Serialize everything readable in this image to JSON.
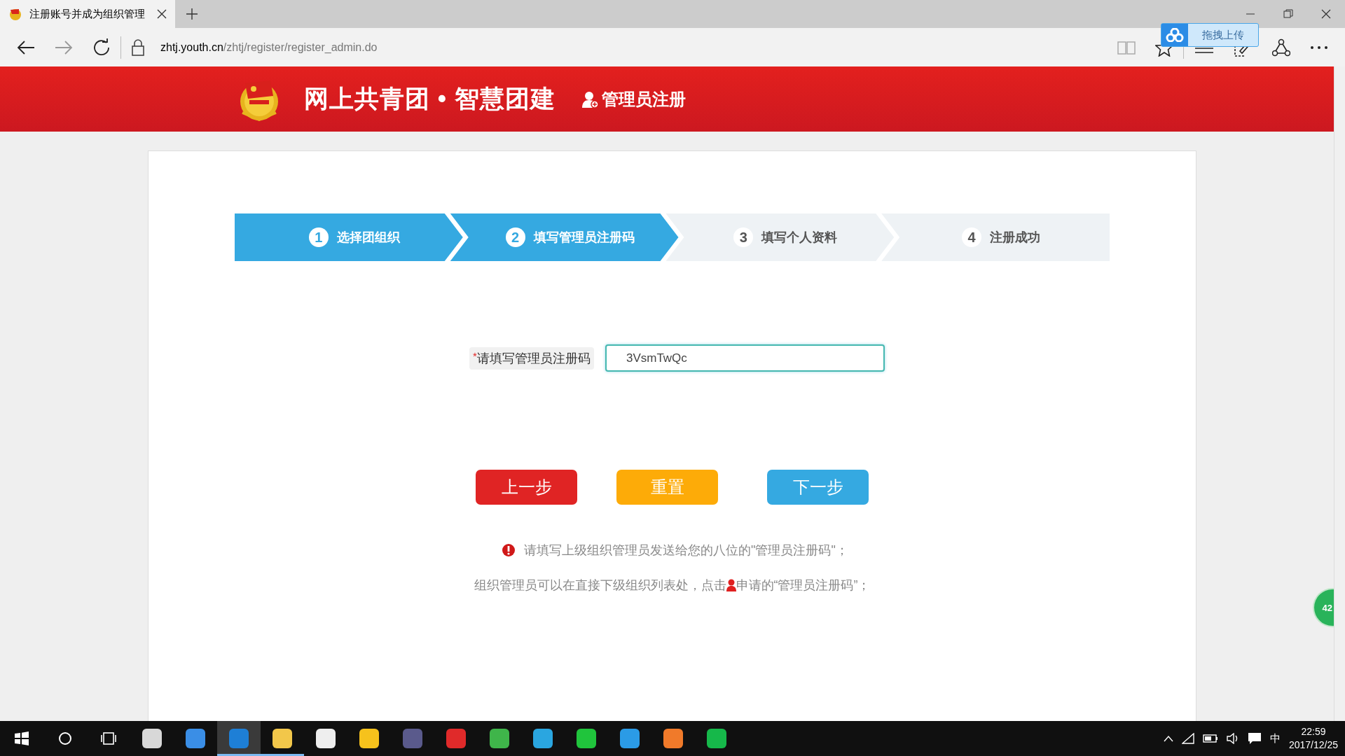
{
  "browser": {
    "tab": {
      "title": "注册账号并成为组织管理",
      "selected": true
    },
    "address": {
      "host": "zhtj.youth.cn",
      "path": "/zhtj/register/register_admin.do"
    },
    "upload_widget": {
      "label": "拖拽上传"
    }
  },
  "header": {
    "title": "网上共青团 • 智慧团建",
    "subtitle": "管理员注册"
  },
  "steps": [
    {
      "number": "1",
      "label": "选择团组织",
      "active": true
    },
    {
      "number": "2",
      "label": "填写管理员注册码",
      "active": true
    },
    {
      "number": "3",
      "label": "填写个人资料",
      "active": false
    },
    {
      "number": "4",
      "label": "注册成功",
      "active": false
    }
  ],
  "form": {
    "required_mark": "*",
    "label": "请填写管理员注册码",
    "value": "3VsmTwQc"
  },
  "buttons": [
    {
      "label": "上一步",
      "kind": "prev"
    },
    {
      "label": "重置",
      "kind": "reset"
    },
    {
      "label": "下一步",
      "kind": "next"
    }
  ],
  "notes": {
    "line_1": "请填写上级组织管理员发送给您的八位的\"管理员注册码\"；",
    "line_2_before": "组织管理员可以在直接下级组织列表处，点击",
    "line_2_after": "申请的“管理员注册码”；"
  },
  "float_ball": {
    "text": "42"
  },
  "taskbar": {
    "items": [
      {
        "kind": "start",
        "selected": false,
        "running": false
      },
      {
        "kind": "search",
        "selected": false,
        "running": false
      },
      {
        "kind": "taskview",
        "selected": false,
        "running": false
      },
      {
        "kind": "app",
        "color": "#d8d8d8",
        "selected": false,
        "running": false
      },
      {
        "kind": "app",
        "color": "#3a8ee6",
        "selected": false,
        "running": false
      },
      {
        "kind": "app",
        "color": "#1e7fd6",
        "selected": true,
        "running": true
      },
      {
        "kind": "app",
        "color": "#f2c74a",
        "selected": false,
        "running": true
      },
      {
        "kind": "app",
        "color": "#eeeeee",
        "selected": false,
        "running": false
      },
      {
        "kind": "app",
        "color": "#f6c21c",
        "selected": false,
        "running": false
      },
      {
        "kind": "app",
        "color": "#5a5a8c",
        "selected": false,
        "running": false
      },
      {
        "kind": "app",
        "color": "#e02a2a",
        "selected": false,
        "running": false
      },
      {
        "kind": "app",
        "color": "#3fb54a",
        "selected": false,
        "running": false
      },
      {
        "kind": "app",
        "color": "#2aa6e0",
        "selected": false,
        "running": false
      },
      {
        "kind": "app",
        "color": "#20c43c",
        "selected": false,
        "running": false
      },
      {
        "kind": "app",
        "color": "#2b9be6",
        "selected": false,
        "running": false
      },
      {
        "kind": "app",
        "color": "#f07a2a",
        "selected": false,
        "running": false
      },
      {
        "kind": "app",
        "color": "#16b84a",
        "selected": false,
        "running": false
      }
    ],
    "ime": "中",
    "time": "22:59",
    "date": "2017/12/25"
  }
}
